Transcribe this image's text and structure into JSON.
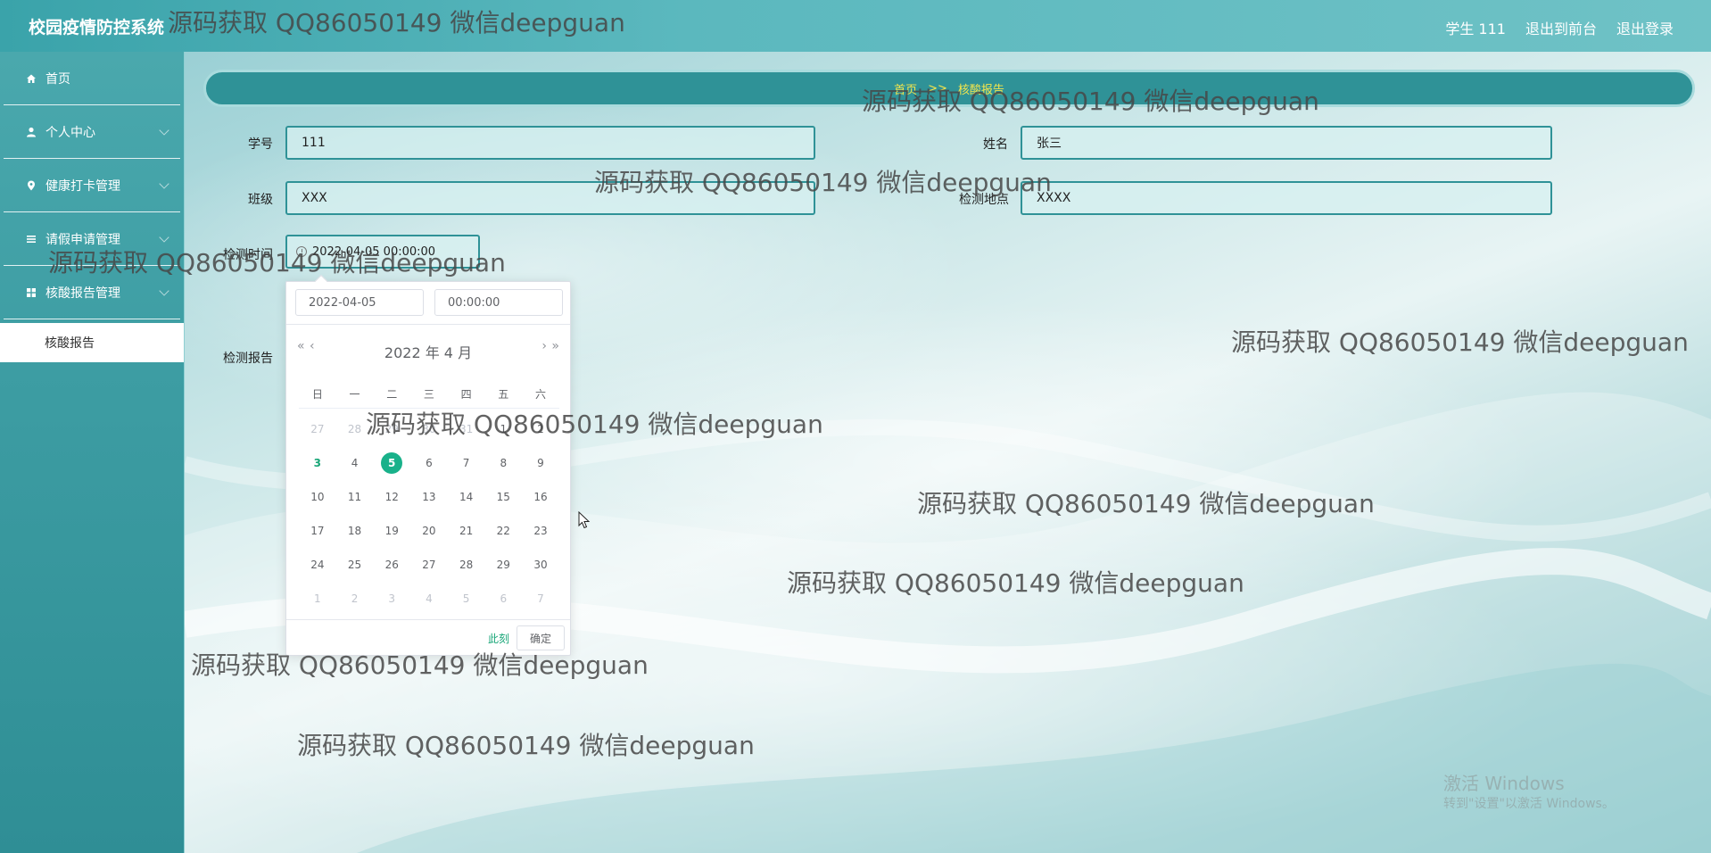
{
  "app": {
    "title": "校园疫情防控系统"
  },
  "header": {
    "user": "学生 111",
    "back_to_front": "退出到前台",
    "logout": "退出登录"
  },
  "sidebar": {
    "items": [
      {
        "label": "首页",
        "icon": "home-icon"
      },
      {
        "label": "个人中心",
        "icon": "user-icon"
      },
      {
        "label": "健康打卡管理",
        "icon": "location-icon"
      },
      {
        "label": "请假申请管理",
        "icon": "list-icon"
      },
      {
        "label": "核酸报告管理",
        "icon": "grid-icon"
      }
    ],
    "active_sub": "核酸报告"
  },
  "breadcrumb": {
    "home": "首页",
    "sep": ">>",
    "current": "核酸报告"
  },
  "form": {
    "student_id": {
      "label": "学号",
      "value": "111"
    },
    "name": {
      "label": "姓名",
      "value": "张三"
    },
    "class": {
      "label": "班级",
      "value": "XXX"
    },
    "location": {
      "label": "检测地点",
      "value": "XXXX"
    },
    "test_time": {
      "label": "检测时间",
      "value": "2022-04-05 00:00:00"
    },
    "report": {
      "label": "检测报告"
    }
  },
  "picker": {
    "date_value": "2022-04-05",
    "time_value": "00:00:00",
    "month_title": "2022 年  4 月",
    "weekdays": [
      "日",
      "一",
      "二",
      "三",
      "四",
      "五",
      "六"
    ],
    "weeks": [
      [
        "27",
        "28",
        "29",
        "30",
        "31",
        "1",
        "2"
      ],
      [
        "3",
        "4",
        "5",
        "6",
        "7",
        "8",
        "9"
      ],
      [
        "10",
        "11",
        "12",
        "13",
        "14",
        "15",
        "16"
      ],
      [
        "17",
        "18",
        "19",
        "20",
        "21",
        "22",
        "23"
      ],
      [
        "24",
        "25",
        "26",
        "27",
        "28",
        "29",
        "30"
      ],
      [
        "1",
        "2",
        "3",
        "4",
        "5",
        "6",
        "7"
      ]
    ],
    "selected": "5",
    "today": "3",
    "now_label": "此刻",
    "ok_label": "确定"
  },
  "watermark": {
    "text": "源码获取 QQ86050149 微信deepguan"
  },
  "windows_notice": {
    "line1": "激活 Windows",
    "line2": "转到\"设置\"以激活 Windows。"
  },
  "colors": {
    "accent": "#2f9297",
    "breadcrumb_text": "#f5e64b",
    "selected_day": "#19b18a"
  }
}
